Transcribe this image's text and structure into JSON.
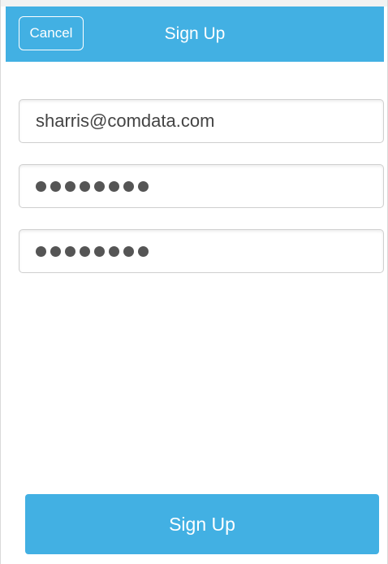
{
  "header": {
    "cancel_label": "Cancel",
    "title": "Sign Up"
  },
  "form": {
    "email": {
      "value": "sharris@comdata.com"
    },
    "password": {
      "masked_length": 8
    },
    "confirm_password": {
      "masked_length": 8
    }
  },
  "footer": {
    "signup_label": "Sign Up"
  },
  "colors": {
    "accent": "#42b0e3",
    "text": "#444444",
    "background": "#ffffff"
  }
}
